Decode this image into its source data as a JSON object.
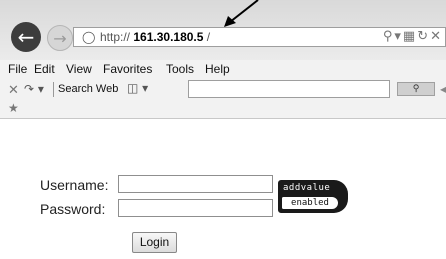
{
  "browser": {
    "address": {
      "protocol": "http://",
      "host": "161.30.180.5",
      "trail": " /"
    },
    "menu": [
      "File",
      "Edit",
      "View",
      "Favorites",
      "Tools",
      "Help"
    ],
    "search_label": "Search Web"
  },
  "login": {
    "username_label": "Username:",
    "password_label": "Password:",
    "button_label": "Login",
    "logo_line1": "addvalue",
    "logo_line2": "enabled"
  }
}
